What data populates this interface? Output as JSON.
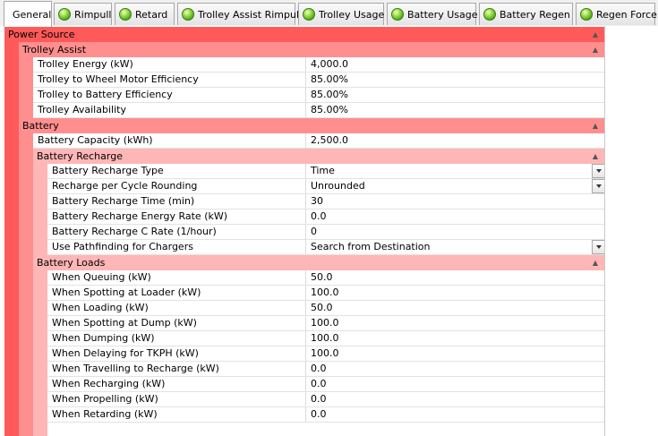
{
  "tabs": [
    {
      "label": "General",
      "active": true,
      "icon": null
    },
    {
      "label": "Rimpull",
      "active": false,
      "icon": "green-status-ball-icon"
    },
    {
      "label": "Retard",
      "active": false,
      "icon": "green-status-ball-icon"
    },
    {
      "label": "Trolley Assist Rimpull",
      "active": false,
      "icon": "green-status-ball-icon"
    },
    {
      "label": "Trolley Usage",
      "active": false,
      "icon": "green-status-ball-icon"
    },
    {
      "label": "Battery Usage",
      "active": false,
      "icon": "green-status-ball-icon"
    },
    {
      "label": "Battery Regen",
      "active": false,
      "icon": "green-status-ball-icon"
    },
    {
      "label": "Regen Force",
      "active": false,
      "icon": "green-status-ball-icon"
    }
  ],
  "colors": {
    "level1": "#ff5a5a",
    "level2": "#ff8f8f",
    "level3": "#ffb6b6"
  },
  "grid": {
    "power_source": {
      "label": "Power Source"
    },
    "trolley_assist": {
      "label": "Trolley Assist",
      "rows": [
        {
          "name": "Trolley Energy (kW)",
          "value": "4,000.0"
        },
        {
          "name": "Trolley to Wheel Motor Efficiency",
          "value": "85.00%"
        },
        {
          "name": "Trolley to Battery Efficiency",
          "value": "85.00%"
        },
        {
          "name": "Trolley Availability",
          "value": "85.00%"
        }
      ]
    },
    "battery": {
      "label": "Battery",
      "rows": [
        {
          "name": "Battery Capacity (kWh)",
          "value": "2,500.0"
        }
      ]
    },
    "battery_recharge": {
      "label": "Battery Recharge",
      "rows": [
        {
          "name": "Battery Recharge Type",
          "value": "Time",
          "dropdown": true
        },
        {
          "name": "Recharge per Cycle Rounding",
          "value": "Unrounded",
          "dropdown": true
        },
        {
          "name": "Battery Recharge Time (min)",
          "value": "30"
        },
        {
          "name": "Battery Recharge Energy Rate (kW)",
          "value": "0.0"
        },
        {
          "name": "Battery Recharge C Rate (1/hour)",
          "value": "0"
        },
        {
          "name": "Use Pathfinding for Chargers",
          "value": "Search from Destination",
          "dropdown": true
        }
      ]
    },
    "battery_loads": {
      "label": "Battery Loads",
      "rows": [
        {
          "name": "When Queuing (kW)",
          "value": "50.0"
        },
        {
          "name": "When Spotting at Loader (kW)",
          "value": "100.0"
        },
        {
          "name": "When Loading (kW)",
          "value": "50.0"
        },
        {
          "name": "When Spotting at Dump (kW)",
          "value": "100.0"
        },
        {
          "name": "When Dumping (kW)",
          "value": "100.0"
        },
        {
          "name": "When Delaying for TKPH (kW)",
          "value": "100.0"
        },
        {
          "name": "When Travelling to Recharge (kW)",
          "value": "0.0"
        },
        {
          "name": "When Recharging (kW)",
          "value": "0.0"
        },
        {
          "name": "When Propelling (kW)",
          "value": "0.0"
        },
        {
          "name": "When Retarding (kW)",
          "value": "0.0"
        }
      ]
    }
  }
}
